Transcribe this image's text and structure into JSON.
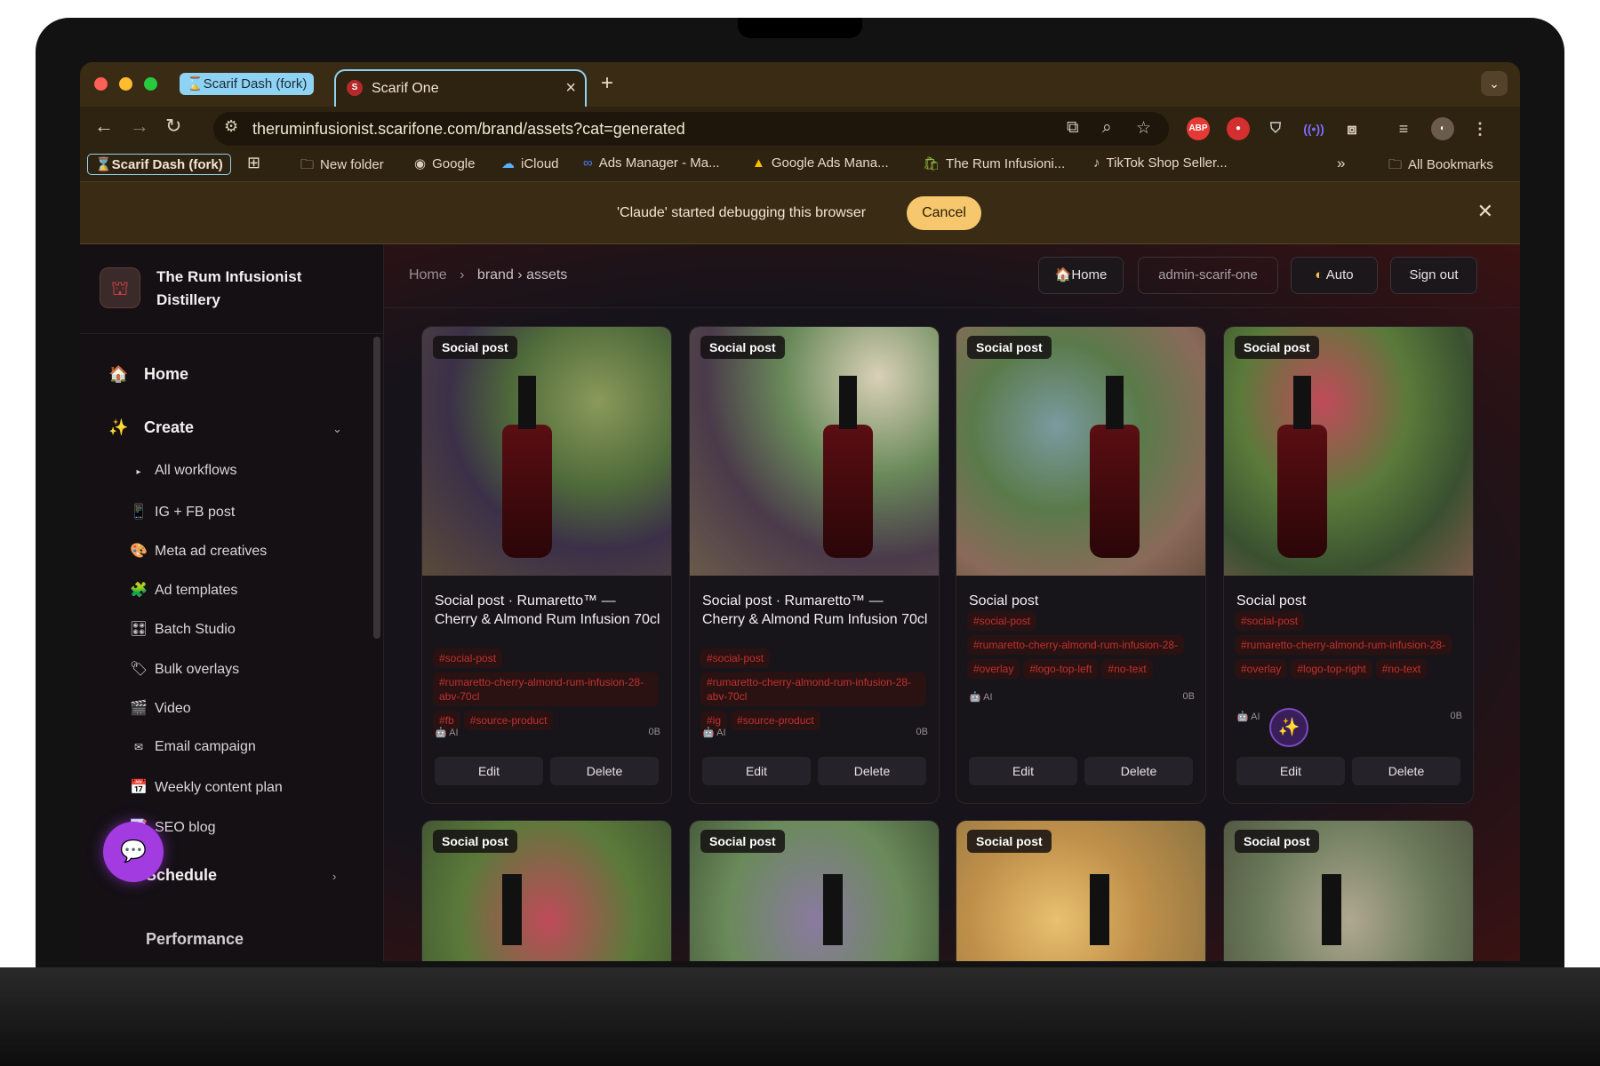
{
  "browser": {
    "tab_group_label": "⌛Scarif Dash (fork)",
    "active_tab_title": "Scarif One",
    "active_tab_favicon": "S",
    "url": "theruminfusionist.scarifone.com/brand/assets?cat=generated",
    "bookmarks": [
      {
        "icon": "folder-icon",
        "label": "New folder"
      },
      {
        "icon": "google-icon",
        "label": "Google"
      },
      {
        "icon": "icloud-icon",
        "label": "iCloud"
      },
      {
        "icon": "meta-icon",
        "label": "Ads Manager - Ma..."
      },
      {
        "icon": "google-ads-icon",
        "label": "Google Ads Mana..."
      },
      {
        "icon": "shopify-icon",
        "label": "The Rum Infusioni..."
      },
      {
        "icon": "tiktok-icon",
        "label": "TikTok Shop Seller..."
      }
    ],
    "bookmark_fork_label": "⌛Scarif Dash (fork)",
    "more_bookmarks": "»",
    "all_bookmarks": "All Bookmarks",
    "debug_message": "'Claude' started debugging this browser",
    "debug_cancel": "Cancel"
  },
  "sidebar": {
    "brand_name": "The Rum Infusionist Distillery",
    "nav_home": "Home",
    "nav_create": "Create",
    "nav_schedule": "Schedule",
    "nav_performance": "Performance",
    "create_items": [
      {
        "icon": "▸",
        "label": "All workflows"
      },
      {
        "icon": "📱",
        "label": "IG + FB post"
      },
      {
        "icon": "🎨",
        "label": "Meta ad creatives"
      },
      {
        "icon": "🧩",
        "label": "Ad templates"
      },
      {
        "icon": "🎛",
        "label": "Batch Studio"
      },
      {
        "icon": "🏷",
        "label": "Bulk overlays"
      },
      {
        "icon": "🎬",
        "label": "Video"
      },
      {
        "icon": "✉",
        "label": "Email campaign"
      },
      {
        "icon": "📅",
        "label": "Weekly content plan"
      },
      {
        "icon": "📝",
        "label": "SEO blog"
      }
    ]
  },
  "header": {
    "breadcrumb_home": "Home",
    "breadcrumb_sep": "›",
    "breadcrumb_path": "brand › assets",
    "home_button": "🏠Home",
    "account_label": "admin-scarif-one",
    "theme_button": "Auto",
    "signout_button": "Sign out"
  },
  "cards": [
    {
      "badge": "Social post",
      "title": "Social post · Rumaretto™ — Cherry & Almond Rum Infusion 70cl",
      "tags": [
        "#social-post",
        "#rumaretto-cherry-almond-rum-infusion-28-abv-70cl",
        "#fb",
        "#source-product"
      ],
      "source": "AI",
      "size": "0B",
      "edit": "Edit",
      "delete": "Delete"
    },
    {
      "badge": "Social post",
      "title": "Social post · Rumaretto™ — Cherry & Almond Rum Infusion 70cl",
      "tags": [
        "#social-post",
        "#rumaretto-cherry-almond-rum-infusion-28-abv-70cl",
        "#ig",
        "#source-product"
      ],
      "source": "AI",
      "size": "0B",
      "edit": "Edit",
      "delete": "Delete"
    },
    {
      "badge": "Social post",
      "title": "Social post",
      "tags": [
        "#social-post",
        "#rumaretto-cherry-almond-rum-infusion-28-",
        "#overlay",
        "#logo-top-left",
        "#no-text"
      ],
      "source": "AI",
      "size": "0B",
      "edit": "Edit",
      "delete": "Delete"
    },
    {
      "badge": "Social post",
      "title": "Social post",
      "tags": [
        "#social-post",
        "#rumaretto-cherry-almond-rum-infusion-28-",
        "#overlay",
        "#logo-top-right",
        "#no-text"
      ],
      "source": "AI",
      "size": "0B",
      "edit": "Edit",
      "delete": "Delete"
    }
  ],
  "second_row_badges": [
    "Social post",
    "Social post",
    "Social post",
    "Social post"
  ]
}
